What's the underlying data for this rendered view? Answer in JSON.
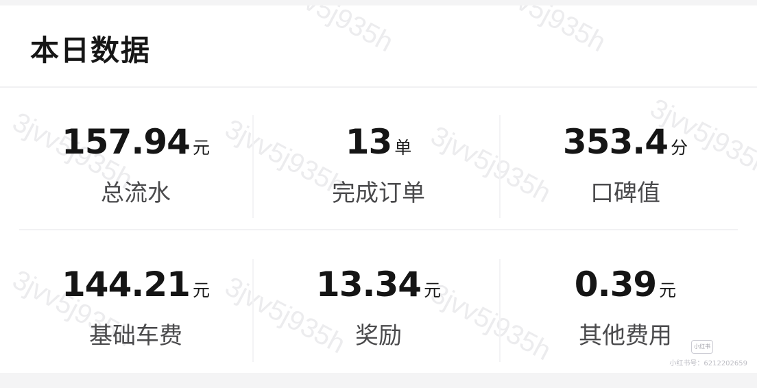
{
  "header": {
    "title": "本日数据"
  },
  "stats": [
    {
      "value": "157.94",
      "unit": "元",
      "label": "总流水"
    },
    {
      "value": "13",
      "unit": "单",
      "label": "完成订单"
    },
    {
      "value": "353.4",
      "unit": "分",
      "label": "口碑值"
    },
    {
      "value": "144.21",
      "unit": "元",
      "label": "基础车费"
    },
    {
      "value": "13.34",
      "unit": "元",
      "label": "奖励"
    },
    {
      "value": "0.39",
      "unit": "元",
      "label": "其他费用"
    }
  ],
  "watermark": {
    "text": "3jvv5j935h"
  },
  "footer": {
    "badge": "小红书",
    "account": "小红书号：6212202659"
  }
}
